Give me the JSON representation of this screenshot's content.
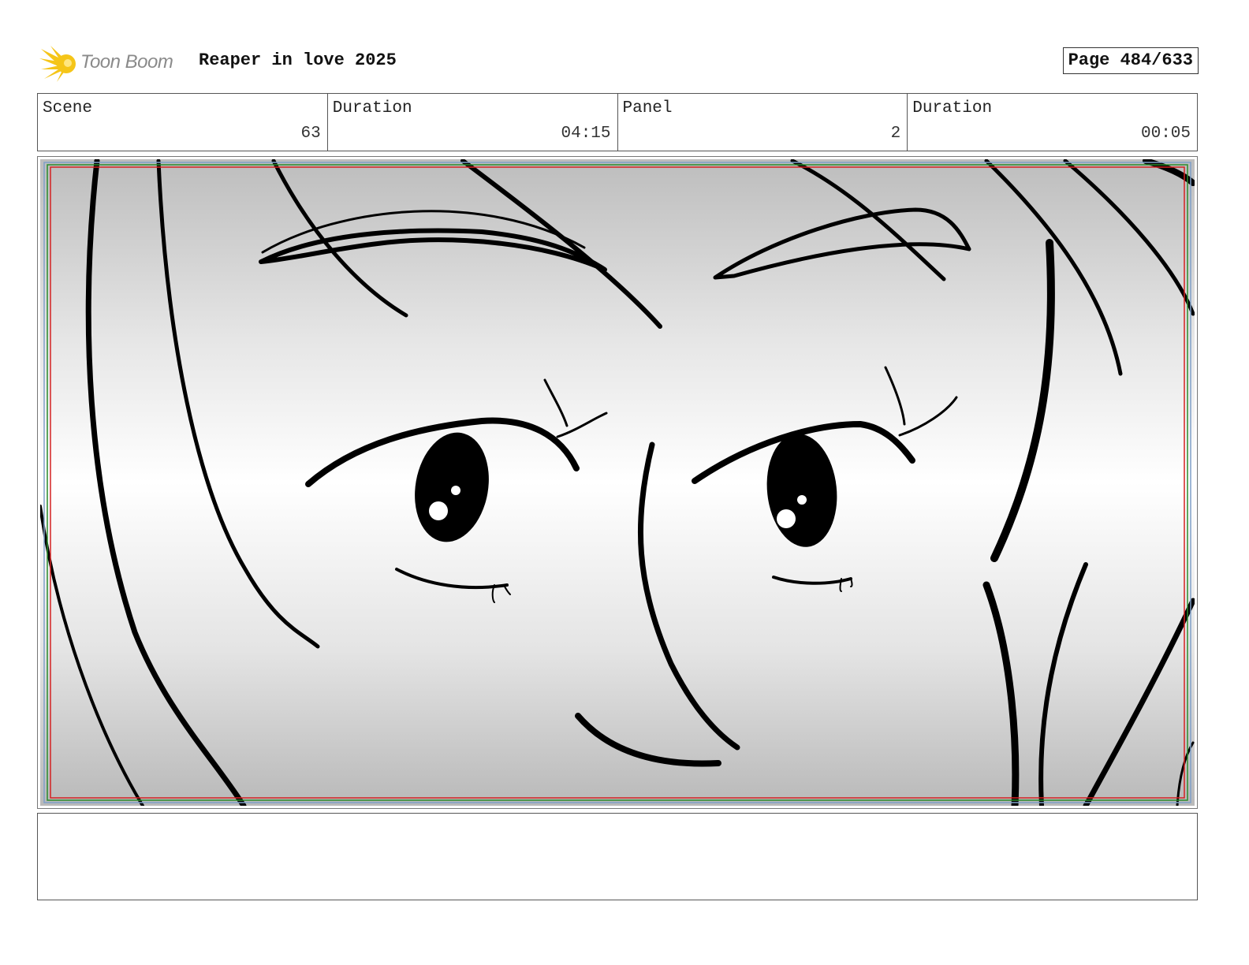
{
  "header": {
    "logo_text": "Toon Boom",
    "title": "Reaper in love 2025",
    "page_label": "Page 484/633"
  },
  "info": {
    "scene_label": "Scene",
    "scene_value": "63",
    "scene_duration_label": "Duration",
    "scene_duration_value": "04:15",
    "panel_label": "Panel",
    "panel_value": "2",
    "panel_duration_label": "Duration",
    "panel_duration_value": "00:05"
  },
  "notes": {
    "text": ""
  },
  "colors": {
    "logo_yellow": "#f5c518",
    "safe_frame_red": "#d42020",
    "safe_frame_green": "#2a8a2a",
    "frame_blue": "#7f9fc8",
    "ink": "#000000"
  },
  "icons": {
    "logo": "toon-boom-starburst-icon"
  }
}
